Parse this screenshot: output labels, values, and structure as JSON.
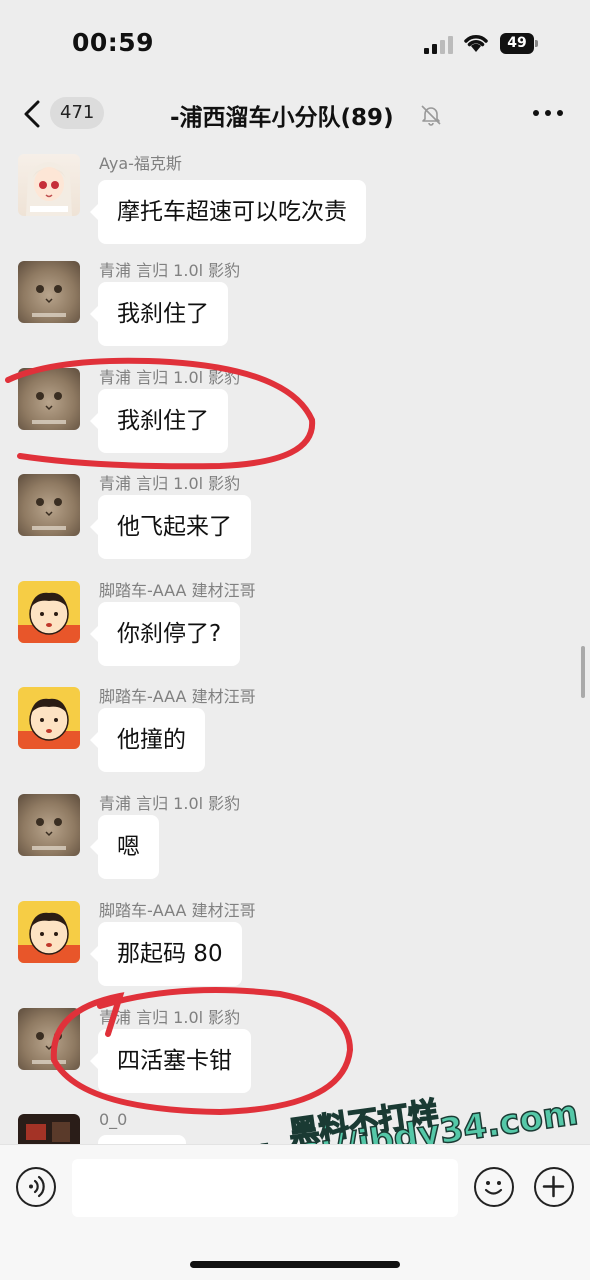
{
  "status": {
    "time": "00:59",
    "battery": "49"
  },
  "nav": {
    "back_icon": "chevron-left-icon",
    "unread": "471",
    "title": "-浦西溜车小分队(89)",
    "mute_icon": "bell-slash-icon",
    "more_icon": "more-dots-icon"
  },
  "messages": [
    {
      "sender": "Aya-福克斯",
      "text": "摩托车超速可以吃次责",
      "avatar": "anime-girl"
    },
    {
      "sender": "青浦  言归  1.0l  影豹",
      "text": "我刹住了",
      "avatar": "cat"
    },
    {
      "sender": "青浦  言归  1.0l  影豹",
      "text": "我刹住了",
      "avatar": "cat"
    },
    {
      "sender": "青浦  言归  1.0l  影豹",
      "text": "他飞起来了",
      "avatar": "cat"
    },
    {
      "sender": "脚踏车-AAA 建材汪哥",
      "text": "你刹停了?",
      "avatar": "cartoon-boy"
    },
    {
      "sender": "脚踏车-AAA 建材汪哥",
      "text": "他撞的",
      "avatar": "cartoon-boy"
    },
    {
      "sender": "青浦  言归  1.0l  影豹",
      "text": "嗯",
      "avatar": "cat"
    },
    {
      "sender": "脚踏车-AAA 建材汪哥",
      "text": "那起码 80",
      "avatar": "cartoon-boy"
    },
    {
      "sender": "青浦  言归  1.0l  影豹",
      "text": "四活塞卡钳",
      "avatar": "cat"
    },
    {
      "sender": "0_0",
      "text": "",
      "avatar": "dark-photo"
    }
  ],
  "watermark": {
    "line1": "黑料不打烊",
    "line2": "https://ibdy34.com"
  },
  "input_bar": {
    "voice_icon": "voice-icon",
    "emoji_icon": "emoji-icon",
    "plus_icon": "plus-icon"
  }
}
